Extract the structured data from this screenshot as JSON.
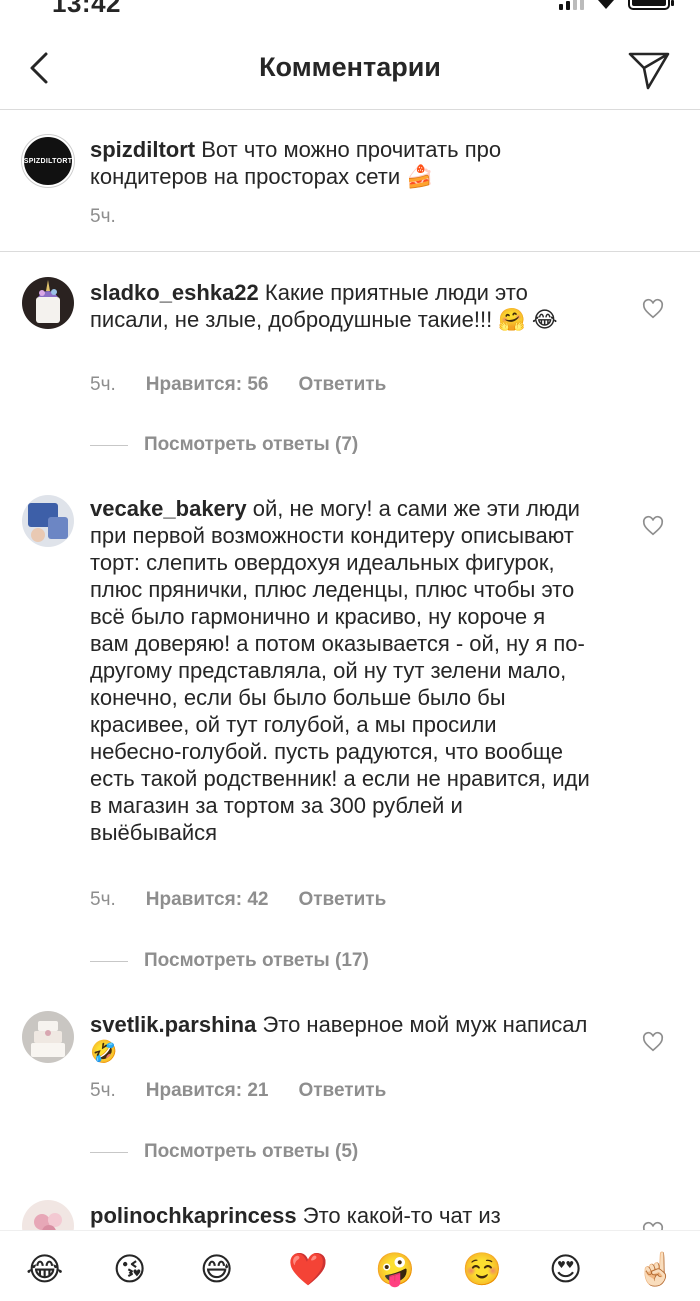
{
  "status_bar": {
    "time": "13:42"
  },
  "header": {
    "title": "Комментарии"
  },
  "caption": {
    "avatar_text": "SPIZDILTORT",
    "username": "spizdiltort",
    "text": "Вот что можно прочитать про кондитеров на просторах сети 🍰",
    "time": "5ч."
  },
  "comments": [
    {
      "username": "sladko_eshka22",
      "text": "Какие приятные люди это писали,  не злые,  добродушные такие!!! 🤗 😂",
      "time": "5ч.",
      "likes": "Нравится: 56",
      "reply": "Ответить",
      "view_replies": "Посмотреть ответы (7)"
    },
    {
      "username": "vecake_bakery",
      "text": "ой, не могу! а сами же эти люди при первой возможности кондитеру описывают торт: слепить овердохуя идеальных фигурок, плюс прянички, плюс леденцы, плюс чтобы это всё было гармонично и красиво, ну короче я вам доверяю! а потом оказывается - ой, ну я по-другому представляла, ой ну тут зелени мало, конечно, если бы было больше было бы красивее, ой тут голубой, а мы просили небесно-голубой. пусть радуются, что вообще есть такой родственник! а если не нравится, иди в магазин за тортом за 300 рублей и выёбывайся",
      "time": "5ч.",
      "likes": "Нравится: 42",
      "reply": "Ответить",
      "view_replies": "Посмотреть ответы (17)"
    },
    {
      "username": "svetlik.parshina",
      "text": "Это наверное мой муж написал 🤣",
      "time": "5ч.",
      "likes": "Нравится: 21",
      "reply": "Ответить",
      "view_replies": "Посмотреть ответы (5)"
    },
    {
      "username": "polinochkaprincess",
      "text": "Это какой-то чат из"
    }
  ],
  "emoji_bar": [
    "😂",
    "😘",
    "😅",
    "❤️",
    "🤪",
    "☺️",
    "😍",
    "☝🏻"
  ],
  "colors": {
    "text": "#262626",
    "secondary": "#8e8e8e",
    "divider": "#dbdbdb"
  }
}
